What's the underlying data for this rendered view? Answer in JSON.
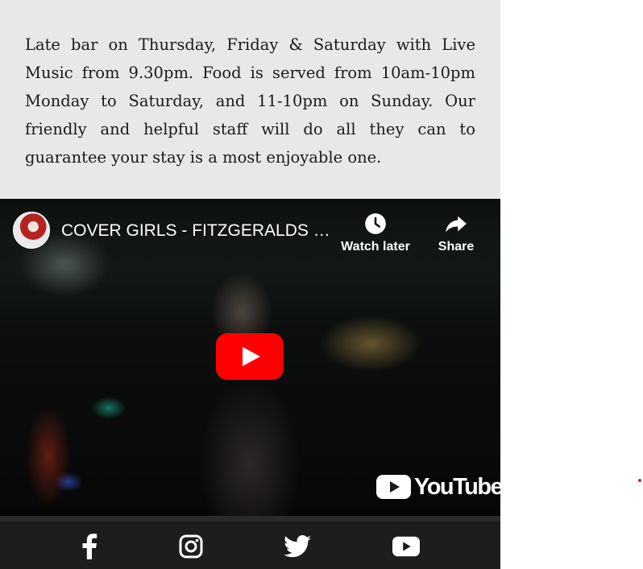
{
  "intro": {
    "text": "Late bar on Thursday, Friday & Saturday with Live Music from 9.30pm. Food is served from 10am-10pm Monday to Saturday, and 11-10pm on Sunday. Our friendly and helpful staff will do all they can to guarantee your stay is a most enjoyable one."
  },
  "video": {
    "title": "COVER GIRLS - FITZGERALDS BAR",
    "watch_later_label": "Watch later",
    "share_label": "Share",
    "logo_text": "YouTube",
    "play_color": "#ff0000"
  },
  "social": {
    "icons": [
      "facebook-icon",
      "instagram-icon",
      "twitter-icon",
      "youtube-icon"
    ],
    "bar_color": "#1d1d1d"
  },
  "colors": {
    "panel_bg": "#e8e8e8",
    "accent_dot": "#d42a1e"
  }
}
